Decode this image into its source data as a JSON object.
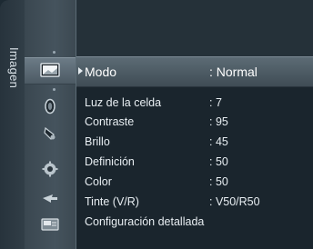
{
  "menu": {
    "category_title": "Imagen",
    "icons": [
      {
        "name": "picture-icon",
        "selected": true
      },
      {
        "name": "sound-icon",
        "selected": false
      },
      {
        "name": "channel-icon",
        "selected": false
      },
      {
        "name": "setup-icon",
        "selected": false
      },
      {
        "name": "input-icon",
        "selected": false
      },
      {
        "name": "application-icon",
        "selected": false
      }
    ],
    "selected_item": {
      "label": "Modo",
      "value": ": Normal"
    },
    "items": [
      {
        "label": "Luz de la celda",
        "value": ": 7"
      },
      {
        "label": "Contraste",
        "value": ": 95"
      },
      {
        "label": "Brillo",
        "value": ": 45"
      },
      {
        "label": "Definición",
        "value": ": 50"
      },
      {
        "label": "Color",
        "value": ": 50"
      },
      {
        "label": "Tinte (V/R)",
        "value": ": V50/R50"
      },
      {
        "label": "Configuración detallada",
        "value": ""
      }
    ]
  },
  "colors": {
    "background": "#1d2a33",
    "highlight": "#5c6b75",
    "text": "#e8eef2"
  }
}
